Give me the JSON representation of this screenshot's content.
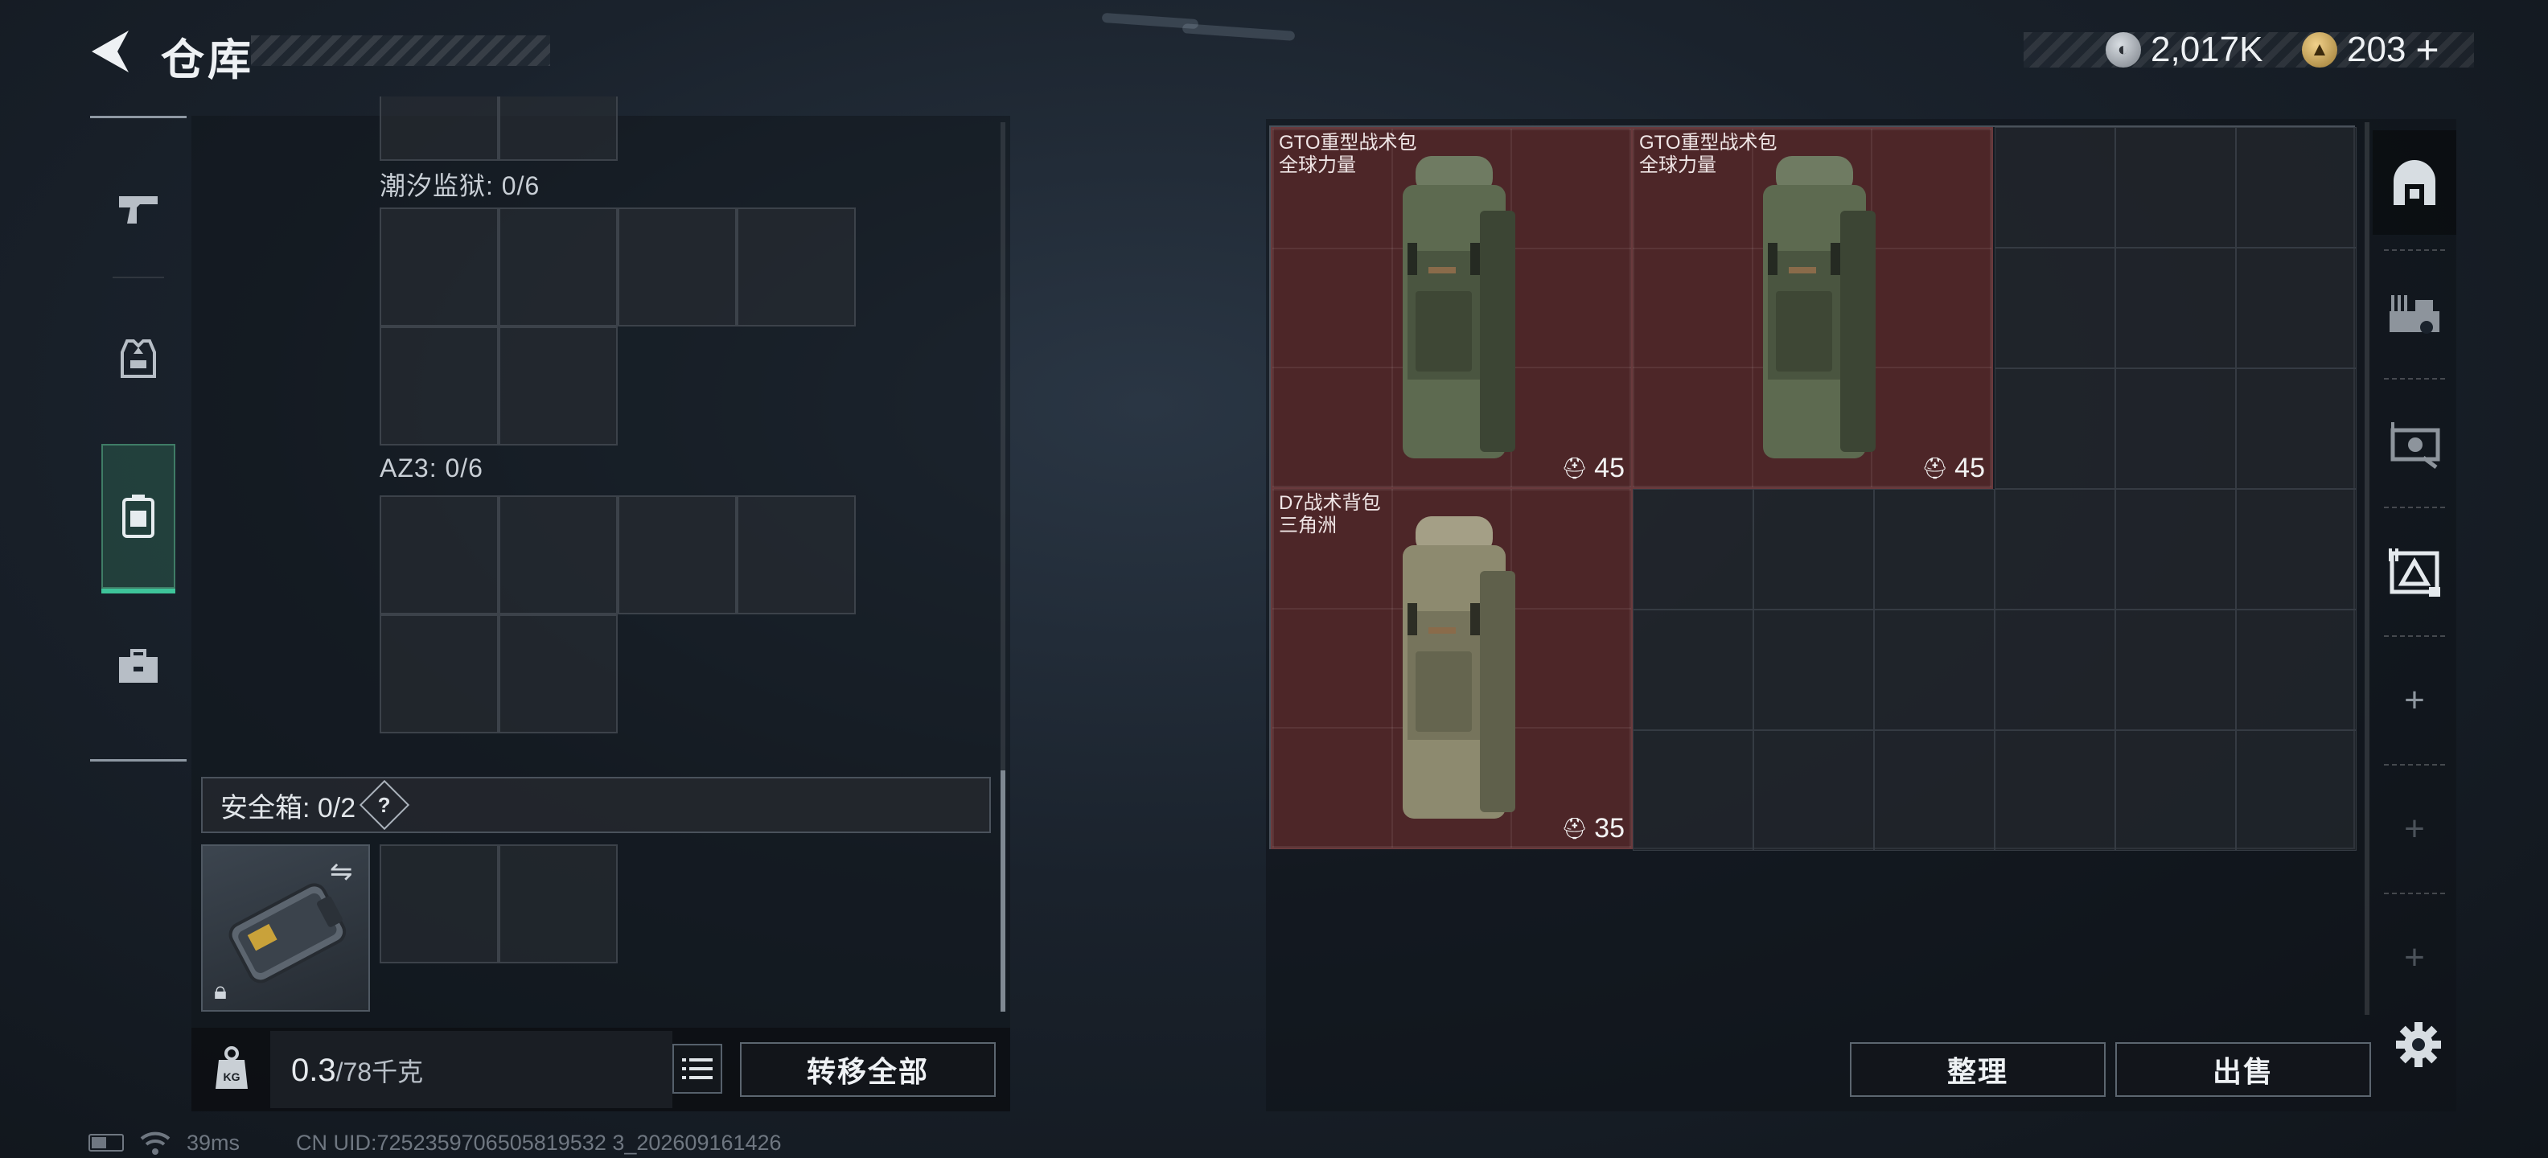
{
  "header": {
    "title": "仓库"
  },
  "currency": {
    "silver": {
      "value": "2,017K",
      "icon": "silver-coin-icon"
    },
    "gold": {
      "value": "203",
      "plus": "+",
      "icon": "gold-triangle-coin-icon"
    }
  },
  "left_rail": {
    "tabs": [
      {
        "name": "weapon",
        "icon": "pistol-icon",
        "active": false
      },
      {
        "name": "armor",
        "icon": "vest-icon",
        "active": false
      },
      {
        "name": "backpack",
        "icon": "backpack-icon",
        "active": true
      },
      {
        "name": "case",
        "icon": "toolbox-icon",
        "active": false
      }
    ],
    "accent": "#3ec49a"
  },
  "left_panel": {
    "containers": [
      {
        "label": "潮汐监狱: 0/6"
      },
      {
        "label": "AZ3: 0/6"
      }
    ],
    "safe_box": {
      "label": "安全箱: 0/2",
      "help": "?"
    }
  },
  "weight": {
    "value": "0.3",
    "capacity": "/78千克",
    "icon": "kg-weight-icon"
  },
  "buttons": {
    "transfer_all": "转移全部",
    "sort": "整理",
    "sell": "出售"
  },
  "items": [
    {
      "name": "GTO重型战术包",
      "brand": "全球力量",
      "capacity": "45",
      "color": "#4d2628"
    },
    {
      "name": "GTO重型战术包",
      "brand": "全球力量",
      "capacity": "45",
      "color": "#4d2628"
    },
    {
      "name": "D7战术背包",
      "brand": "三角洲",
      "capacity": "35",
      "color": "#4d2628"
    }
  ],
  "right_rail": {
    "slots": [
      {
        "icon": "stash-arch-icon"
      },
      {
        "icon": "equipment-bench-icon"
      },
      {
        "icon": "crate-icon"
      },
      {
        "icon": "triangle-container-icon"
      }
    ],
    "plus": "+"
  },
  "status": {
    "ping": "39ms",
    "uid": "CN UID:7252359706505819532 3_202609161426"
  }
}
